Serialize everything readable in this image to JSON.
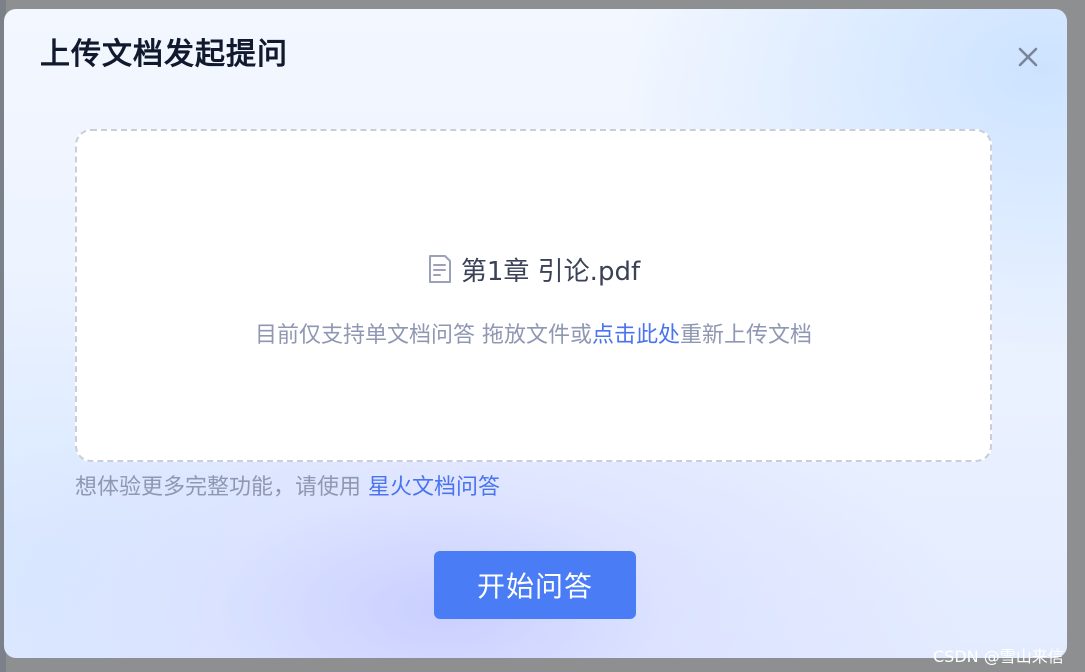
{
  "dialog": {
    "title": "上传文档发起提问",
    "close_icon": "close-icon"
  },
  "dropzone": {
    "file_icon": "document-icon",
    "file_name": "第1章 引论.pdf",
    "hint_before": "目前仅支持单文档问答 拖放文件或",
    "hint_link": "点击此处",
    "hint_after": "重新上传文档"
  },
  "promo": {
    "text": "想体验更多完整功能，请使用 ",
    "link": "星火文档问答"
  },
  "actions": {
    "start_label": "开始问答"
  },
  "watermark": {
    "text": "CSDN @雪山来信"
  },
  "colors": {
    "accent": "#4a7cf6",
    "link": "#4a74ef",
    "title": "#10192e",
    "muted_text": "#8f97b2"
  }
}
